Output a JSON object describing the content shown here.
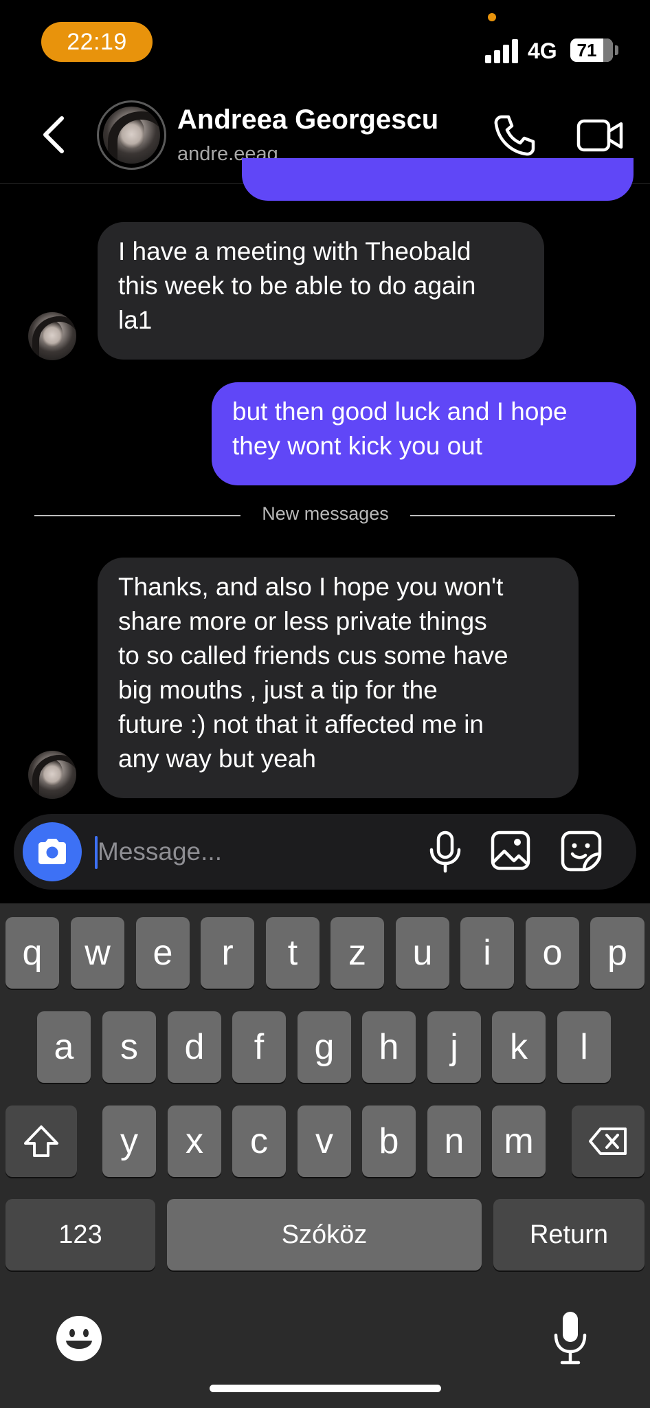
{
  "status_bar": {
    "time": "22:19",
    "network": "4G",
    "battery": "71"
  },
  "header": {
    "contact_name": "Andreea Georgescu",
    "contact_handle": "andre.eeag",
    "icons": [
      "back-chevron-icon",
      "phone-icon",
      "video-camera-icon"
    ]
  },
  "messages": [
    {
      "sender": "them",
      "text": "I have a meeting with Theobald\nthis week to be able to do again\nla1"
    },
    {
      "sender": "me",
      "text": "but then good luck and I hope\nthey wont kick you out"
    },
    {
      "sender": "them",
      "text": "Thanks, and also I hope you won't\nshare more or less private things\nto so called friends cus some have\nbig mouths , just a tip for the\nfuture :) not that it affected me in\nany way but yeah"
    }
  ],
  "divider": {
    "label": "New messages"
  },
  "composer": {
    "placeholder": "Message...",
    "icons": [
      "camera-icon",
      "microphone-icon",
      "gallery-icon",
      "sticker-icon"
    ]
  },
  "keyboard": {
    "row1": [
      "q",
      "w",
      "e",
      "r",
      "t",
      "z",
      "u",
      "i",
      "o",
      "p"
    ],
    "row2": [
      "a",
      "s",
      "d",
      "f",
      "g",
      "h",
      "j",
      "k",
      "l"
    ],
    "row3": [
      "y",
      "x",
      "c",
      "v",
      "b",
      "n",
      "m"
    ],
    "numbers_label": "123",
    "space_label": "Szóköz",
    "return_label": "Return"
  },
  "colors": {
    "accent_orange": "#e8930c",
    "outgoing_bubble": "#6047f7",
    "incoming_bubble": "#262628",
    "camera_button": "#3d71f5"
  }
}
